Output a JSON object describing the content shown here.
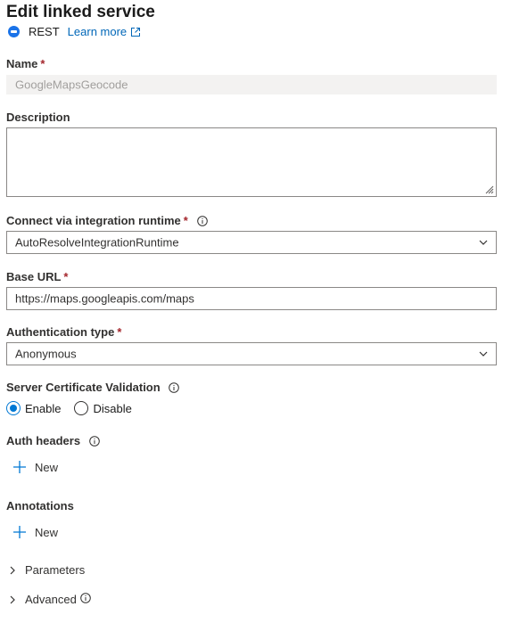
{
  "header": {
    "title": "Edit linked service",
    "type_label": "REST",
    "learn_more": "Learn more"
  },
  "name_field": {
    "label": "Name",
    "required": "*",
    "value": "GoogleMapsGeocode"
  },
  "description_field": {
    "label": "Description",
    "value": ""
  },
  "runtime_field": {
    "label": "Connect via integration runtime",
    "required": "*",
    "value": "AutoResolveIntegrationRuntime"
  },
  "base_url_field": {
    "label": "Base URL",
    "required": "*",
    "value": "https://maps.googleapis.com/maps"
  },
  "auth_type_field": {
    "label": "Authentication type",
    "required": "*",
    "value": "Anonymous"
  },
  "cert_validation": {
    "label": "Server Certificate Validation",
    "options": [
      "Enable",
      "Disable"
    ],
    "selected": "Enable"
  },
  "auth_headers": {
    "label": "Auth headers",
    "new_label": "New"
  },
  "annotations": {
    "label": "Annotations",
    "new_label": "New"
  },
  "sections": {
    "parameters": "Parameters",
    "advanced": "Advanced"
  },
  "colors": {
    "accent": "#0078d4",
    "link": "#0067b8",
    "required": "#a4262c",
    "disabled_bg": "#f3f2f1"
  },
  "icons": [
    "rest-icon",
    "external-link-icon",
    "info-icon",
    "chevron-down-icon",
    "plus-icon",
    "chevron-right-icon",
    "resize-grip-icon"
  ]
}
